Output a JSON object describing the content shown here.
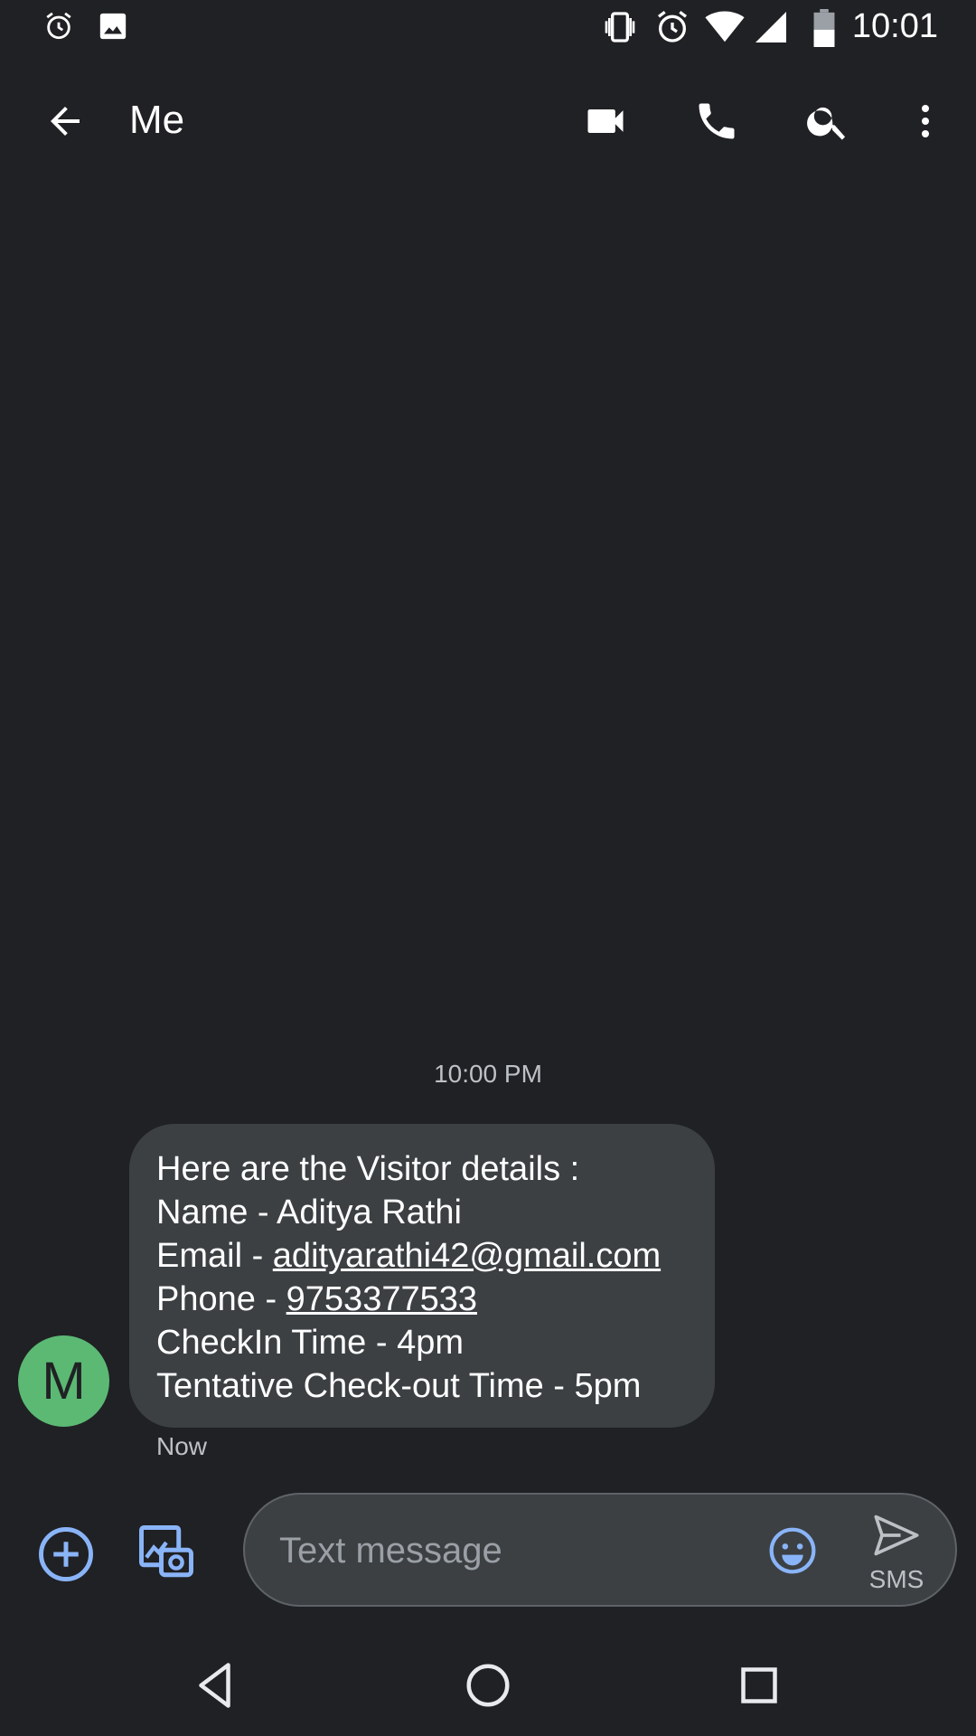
{
  "status_bar": {
    "time": "10:01",
    "left_icons": [
      "alarm-icon",
      "image-icon"
    ],
    "right_icons": [
      "vibrate-icon",
      "alarm-icon",
      "wifi-icon",
      "signal-icon",
      "battery-icon"
    ]
  },
  "app_bar": {
    "title": "Me",
    "actions": [
      "back-arrow-icon",
      "video-call-icon",
      "phone-icon",
      "search-icon",
      "more-vert-icon"
    ]
  },
  "conversation": {
    "timestamp": "10:00 PM",
    "avatar_letter": "M",
    "avatar_color": "#5bb974",
    "message": {
      "line1": "Here are the Visitor details :",
      "line2": "Name - Aditya Rathi",
      "email_prefix": "Email - ",
      "email": "adityarathi42@gmail.com",
      "phone_prefix": "Phone - ",
      "phone": "9753377533",
      "line5": "CheckIn Time - 4pm",
      "line6": "Tentative Check-out Time - 5pm"
    },
    "status": "Now"
  },
  "compose": {
    "placeholder": "Text message",
    "send_label": "SMS",
    "accent": "#8ab4f8"
  },
  "colors": {
    "background": "#202124",
    "bubble": "#3c4043"
  }
}
